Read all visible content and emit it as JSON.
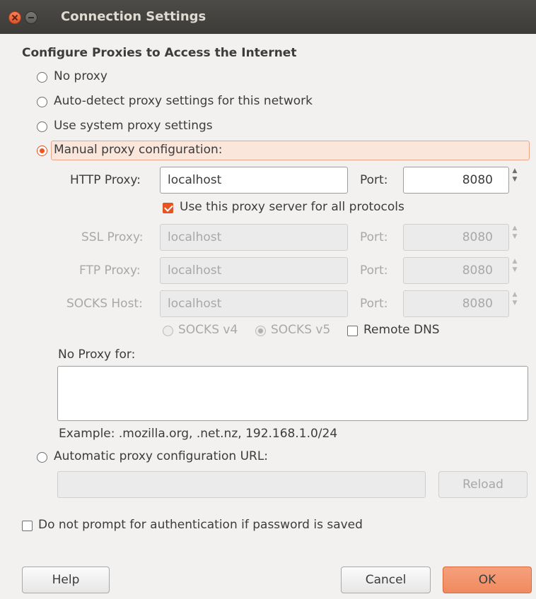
{
  "window": {
    "title": "Connection Settings"
  },
  "heading": "Configure Proxies to Access the Internet",
  "proxy_options": {
    "no_proxy": "No proxy",
    "auto_detect": "Auto-detect proxy settings for this network",
    "system": "Use system proxy settings",
    "manual": "Manual proxy configuration:",
    "selected": "manual"
  },
  "http": {
    "label": "HTTP Proxy:",
    "value": "localhost",
    "port_label": "Port:",
    "port": "8080"
  },
  "use_all": {
    "label": "Use this proxy server for all protocols",
    "checked": true
  },
  "ssl": {
    "label": "SSL Proxy:",
    "value": "localhost",
    "port_label": "Port:",
    "port": "8080"
  },
  "ftp": {
    "label": "FTP Proxy:",
    "value": "localhost",
    "port_label": "Port:",
    "port": "8080"
  },
  "socks": {
    "label": "SOCKS Host:",
    "value": "localhost",
    "port_label": "Port:",
    "port": "8080"
  },
  "socks_version": {
    "v4": "SOCKS v4",
    "v5": "SOCKS v5",
    "selected": "v5"
  },
  "remote_dns": {
    "label": "Remote DNS",
    "checked": false
  },
  "no_proxy_for": {
    "label": "No Proxy for:",
    "value": ""
  },
  "example": "Example: .mozilla.org, .net.nz, 192.168.1.0/24",
  "auto_url": {
    "label": "Automatic proxy configuration URL:",
    "value": "",
    "reload": "Reload"
  },
  "no_prompt": {
    "label": "Do not prompt for authentication if password is saved",
    "checked": false
  },
  "buttons": {
    "help": "Help",
    "cancel": "Cancel",
    "ok": "OK"
  },
  "colors": {
    "accent": "#e95420",
    "titlebar": "#3c3b37"
  }
}
